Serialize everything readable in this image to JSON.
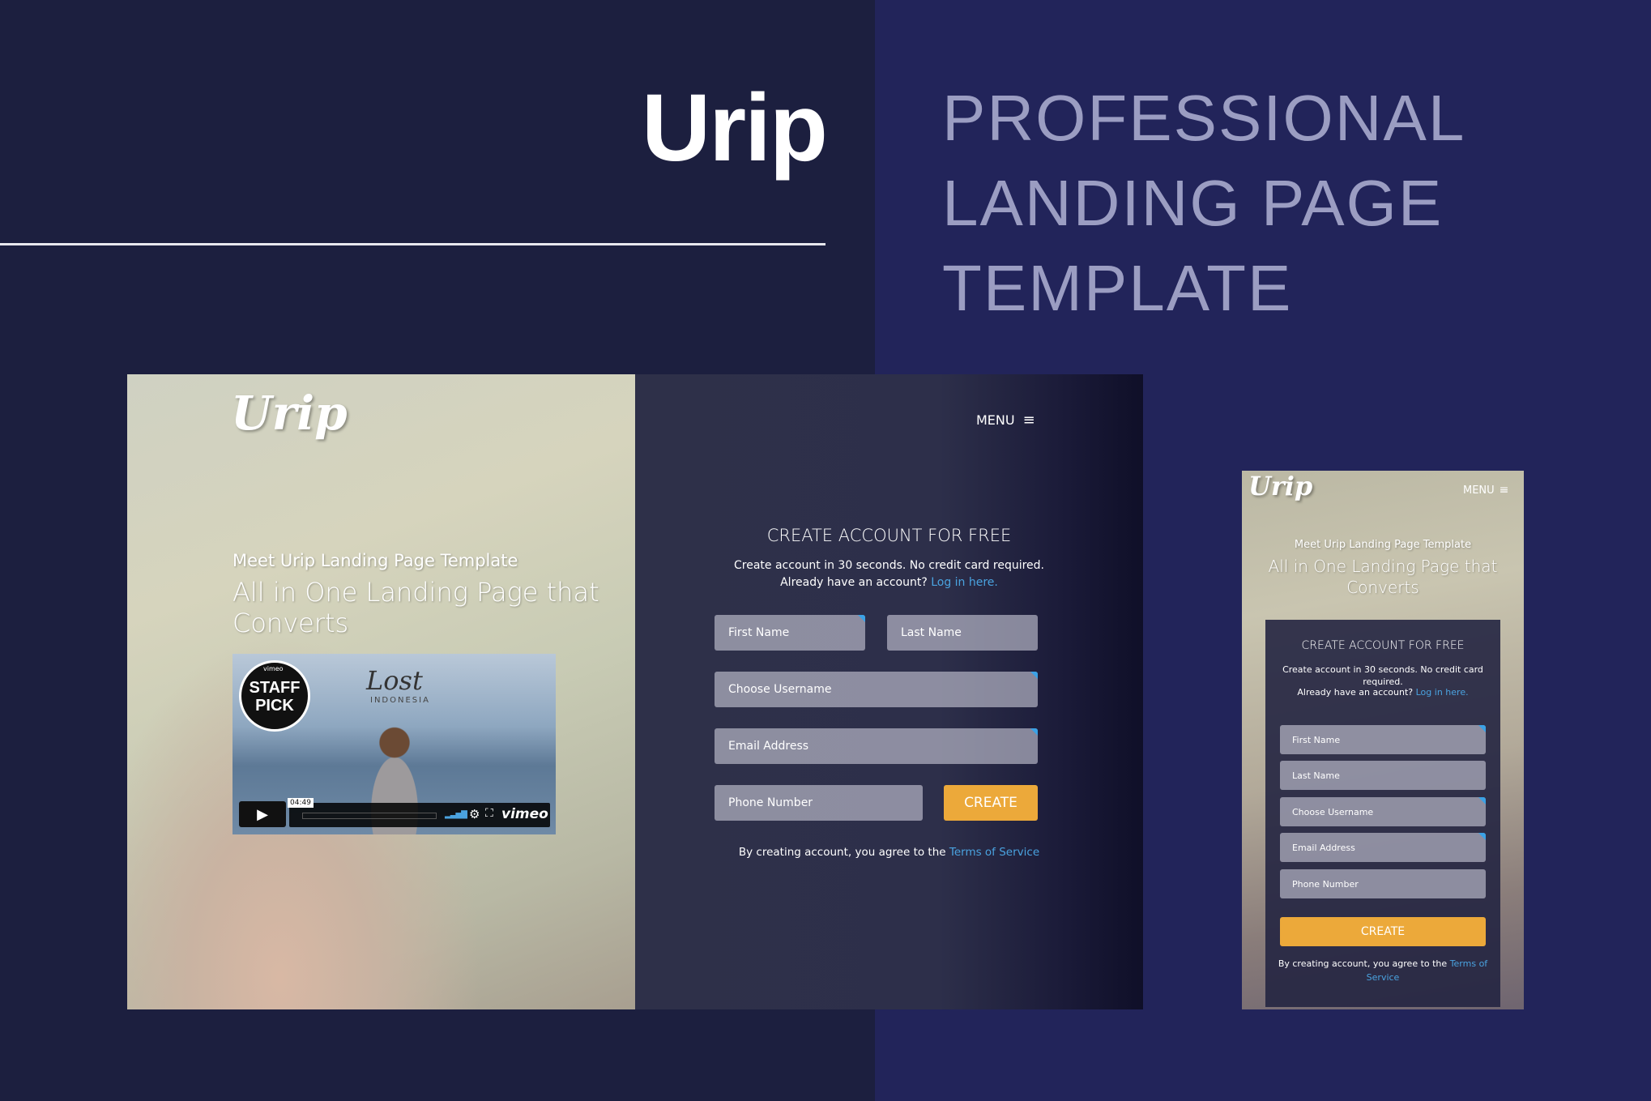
{
  "poster": {
    "brand": "Urip",
    "tagline": [
      "PROFESSIONAL",
      "LANDING PAGE",
      "TEMPLATE"
    ],
    "colors": {
      "bg_left": "#1c1f3f",
      "bg_right": "#22245a",
      "tagline": "#9b9dc2",
      "accent_button": "#eca93a",
      "link": "#4aa3e0"
    }
  },
  "desktop": {
    "logo": "Urip",
    "menu_label": "MENU",
    "menu_icon": "hamburger-icon",
    "kicker": "Meet Urip Landing Page Template",
    "headline": "All in One Landing Page that Converts",
    "video": {
      "badge_top": "vimeo",
      "badge": "STAFF PICK",
      "title": "Lost",
      "title_sub": "INDONESIA",
      "duration": "04:49",
      "provider": "vimeo",
      "icons": [
        "play-icon",
        "volume-icon",
        "gear-icon",
        "fullscreen-icon"
      ]
    },
    "form": {
      "title": "CREATE ACCOUNT FOR FREE",
      "subtitle": "Create account in 30 seconds. No credit card required.",
      "login_prompt": "Already have an account?",
      "login_link": "Log in here.",
      "first_name_placeholder": "First Name",
      "last_name_placeholder": "Last Name",
      "username_placeholder": "Choose Username",
      "email_placeholder": "Email Address",
      "phone_placeholder": "Phone Number",
      "create_label": "CREATE",
      "terms_prefix": "By creating account, you agree to the",
      "terms_link": "Terms of Service"
    }
  },
  "mobile": {
    "logo": "Urip",
    "menu_label": "MENU",
    "kicker": "Meet Urip Landing Page Template",
    "headline": "All in One Landing Page that Converts",
    "form": {
      "title": "CREATE ACCOUNT FOR FREE",
      "subtitle": "Create account in 30 seconds. No credit card required.",
      "login_prompt": "Already have an account?",
      "login_link": "Log in here.",
      "first_name_placeholder": "First Name",
      "last_name_placeholder": "Last Name",
      "username_placeholder": "Choose Username",
      "email_placeholder": "Email Address",
      "phone_placeholder": "Phone Number",
      "create_label": "CREATE",
      "terms_prefix": "By creating account, you agree to the",
      "terms_link": "Terms of Service"
    }
  }
}
